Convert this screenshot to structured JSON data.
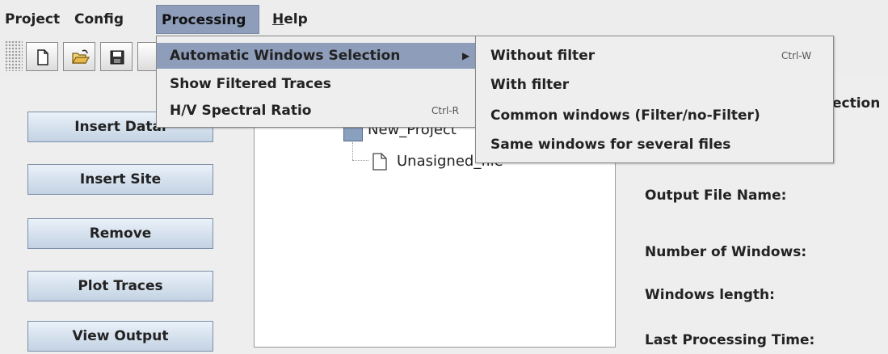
{
  "menubar": {
    "items": [
      {
        "label": "Project"
      },
      {
        "label": "Config"
      },
      {
        "label": "Processing"
      },
      {
        "label": "H",
        "rest": "elp"
      }
    ]
  },
  "toolbar": {
    "buttons": [
      "new-file",
      "open-folder",
      "save"
    ]
  },
  "side_buttons": [
    {
      "label": "Insert Datal"
    },
    {
      "label": "Insert Site"
    },
    {
      "label": "Remove"
    },
    {
      "label": "Plot Traces"
    },
    {
      "label": "View Output"
    }
  ],
  "tree": {
    "project_label": "New_Project",
    "child_label": "Unasigned_file"
  },
  "info": {
    "section_fragment": "ection",
    "output_file": "Output File Name:",
    "num_windows": "Number of Windows:",
    "win_length": "Windows length:",
    "last_time": "Last Processing Time:"
  },
  "processing_menu": {
    "items": [
      {
        "label": "Automatic Windows Selection",
        "submenu": true
      },
      {
        "label": "Show Filtered Traces"
      },
      {
        "label": "H/V Spectral Ratio",
        "accel": "Ctrl-R"
      }
    ]
  },
  "submenu": {
    "items": [
      {
        "label": "Without filter",
        "accel": "Ctrl-W"
      },
      {
        "label": "With filter"
      },
      {
        "label": "Common windows (Filter/no-Filter)"
      },
      {
        "label": "Same windows for several files"
      }
    ]
  },
  "colors": {
    "menu_highlight": "#8e9dba",
    "button_gradient_top": "#eaf1f9",
    "button_gradient_bottom": "#c3d2e3"
  }
}
